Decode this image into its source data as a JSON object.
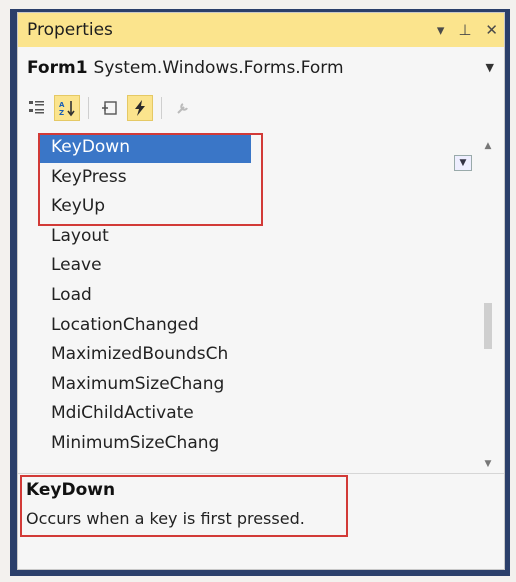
{
  "window": {
    "title": "Properties",
    "controls": {
      "dropdown": "▾",
      "pin": "⊥",
      "close": "✕"
    }
  },
  "object_selector": {
    "name": "Form1",
    "type": "System.Windows.Forms.Form"
  },
  "toolbar": {
    "buttons": [
      {
        "name": "categorized-icon",
        "active": false
      },
      {
        "name": "alphabetical-icon",
        "active": true
      },
      {
        "name": "properties-icon",
        "active": false
      },
      {
        "name": "events-icon",
        "active": true
      },
      {
        "name": "property-pages-icon",
        "active": false
      }
    ]
  },
  "events": [
    "KeyDown",
    "KeyPress",
    "KeyUp",
    "Layout",
    "Leave",
    "Load",
    "LocationChanged",
    "MaximizedBoundsCh",
    "MaximumSizeChang",
    "MdiChildActivate",
    "MinimumSizeChang"
  ],
  "selected_event": "KeyDown",
  "description": {
    "title": "KeyDown",
    "text": "Occurs when a key is first pressed."
  },
  "colors": {
    "titlebar": "#fbe48d",
    "selection": "#3a76c7",
    "highlight": "#d23a37"
  }
}
